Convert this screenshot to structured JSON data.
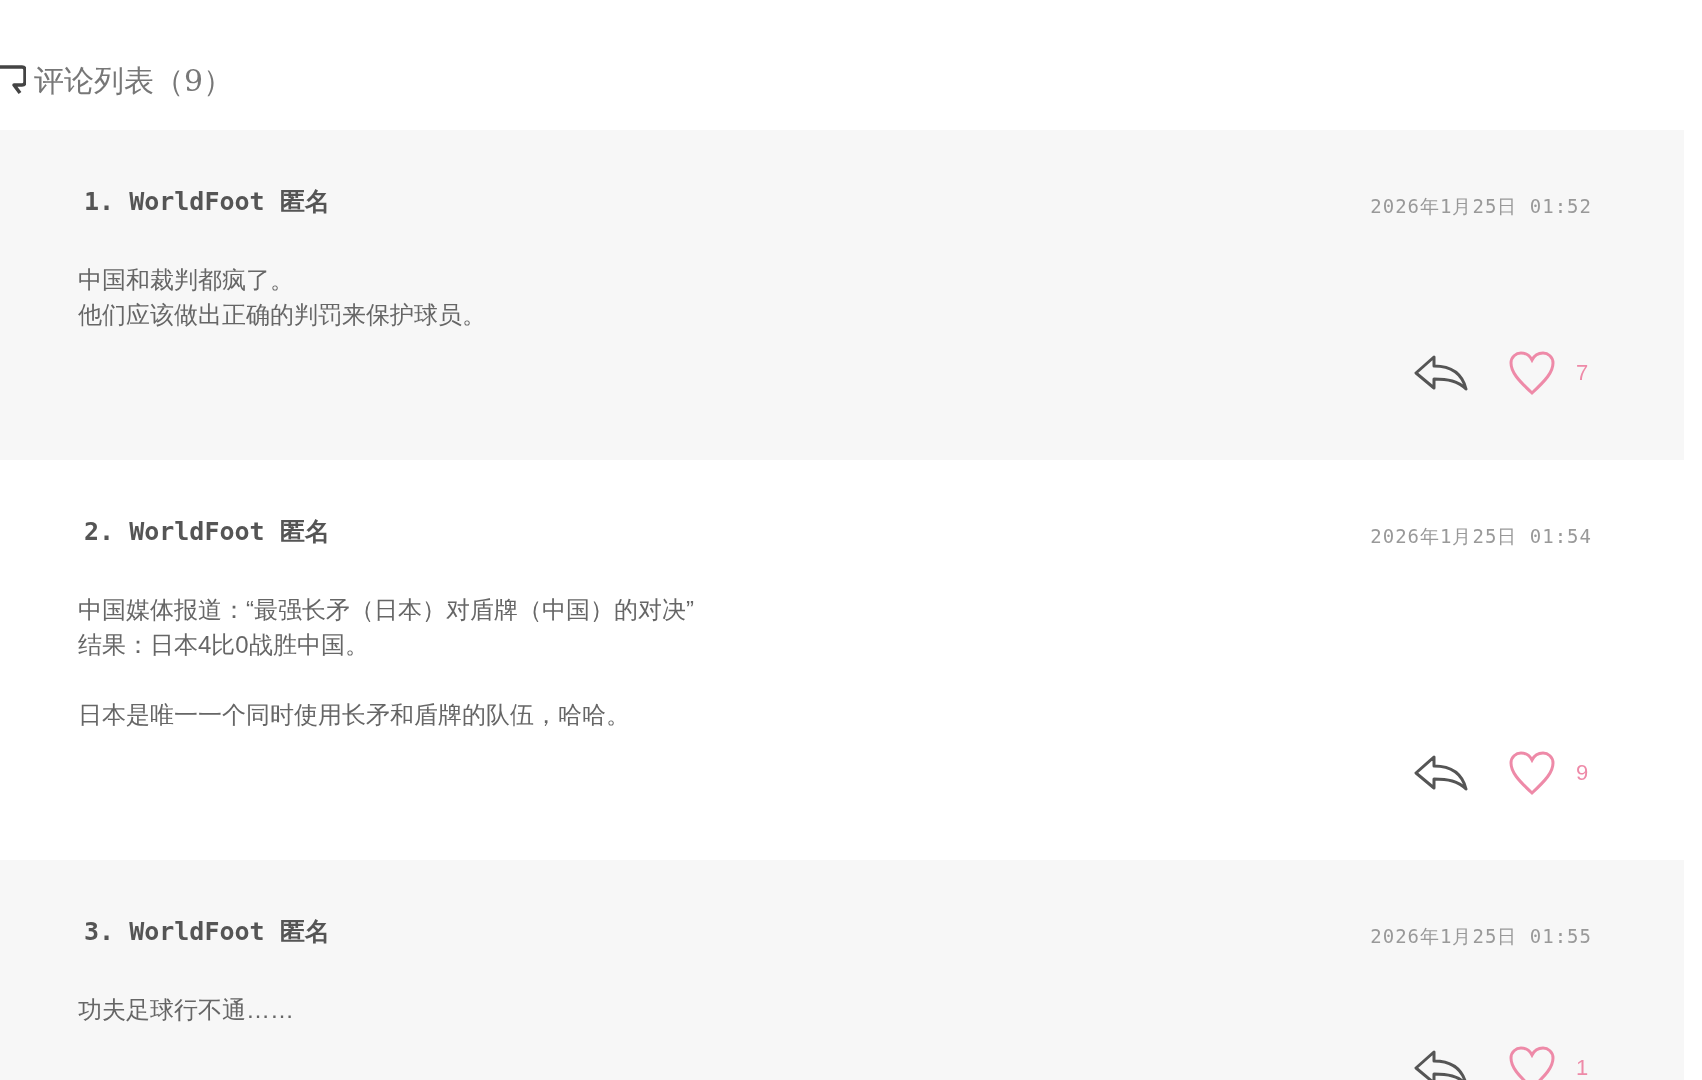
{
  "heading": "评论列表（9）",
  "comments": [
    {
      "number": "1.",
      "author": "WorldFoot",
      "name": "匿名",
      "date": "2026年1月25日 01:52",
      "paragraphs": [
        [
          "中国和裁判都疯了。",
          "他们应该做出正确的判罚来保护球员。"
        ]
      ],
      "likes": "7"
    },
    {
      "number": "2.",
      "author": "WorldFoot",
      "name": "匿名",
      "date": "2026年1月25日 01:54",
      "paragraphs": [
        [
          "中国媒体报道：“最强长矛（日本）对盾牌（中国）的对决”",
          "结果：日本4比0战胜中国。"
        ],
        [
          "日本是唯一一个同时使用长矛和盾牌的队伍，哈哈。"
        ]
      ],
      "likes": "9"
    },
    {
      "number": "3.",
      "author": "WorldFoot",
      "name": "匿名",
      "date": "2026年1月25日 01:55",
      "paragraphs": [
        [
          "功夫足球行不通……"
        ]
      ],
      "likes": "1"
    }
  ]
}
